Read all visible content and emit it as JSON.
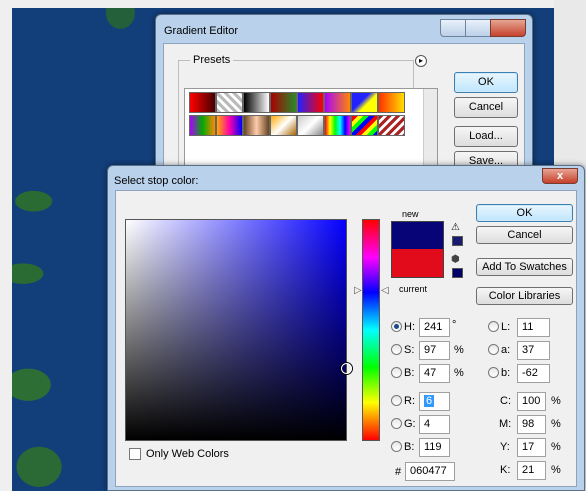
{
  "gradient_editor": {
    "title": "Gradient Editor",
    "presets_label": "Presets",
    "ok_label": "OK",
    "cancel_label": "Cancel",
    "load_label": "Load...",
    "save_label": "Save..."
  },
  "stop_color": {
    "title": "Select stop color:",
    "close_label": "x",
    "ok_label": "OK",
    "cancel_label": "Cancel",
    "add_swatches_label": "Add To Swatches",
    "color_libraries_label": "Color Libraries",
    "new_label": "new",
    "current_label": "current",
    "only_web_label": "Only Web Colors",
    "hex_label": "#",
    "hex_value": "060477",
    "fields": {
      "H": {
        "label": "H:",
        "value": "241",
        "unit": "°"
      },
      "S": {
        "label": "S:",
        "value": "97",
        "unit": "%"
      },
      "Bri": {
        "label": "B:",
        "value": "47",
        "unit": "%"
      },
      "R": {
        "label": "R:",
        "value": "6"
      },
      "G": {
        "label": "G:",
        "value": "4"
      },
      "Blue": {
        "label": "B:",
        "value": "119"
      },
      "L": {
        "label": "L:",
        "value": "11"
      },
      "a": {
        "label": "a:",
        "value": "37"
      },
      "b": {
        "label": "b:",
        "value": "-62"
      },
      "C": {
        "label": "C:",
        "value": "100",
        "unit": "%"
      },
      "M": {
        "label": "M:",
        "value": "98",
        "unit": "%"
      },
      "Y": {
        "label": "Y:",
        "value": "17",
        "unit": "%"
      },
      "K": {
        "label": "K:",
        "value": "21",
        "unit": "%"
      }
    },
    "colors": {
      "new": "#060477",
      "current": "#e10b1c"
    }
  }
}
